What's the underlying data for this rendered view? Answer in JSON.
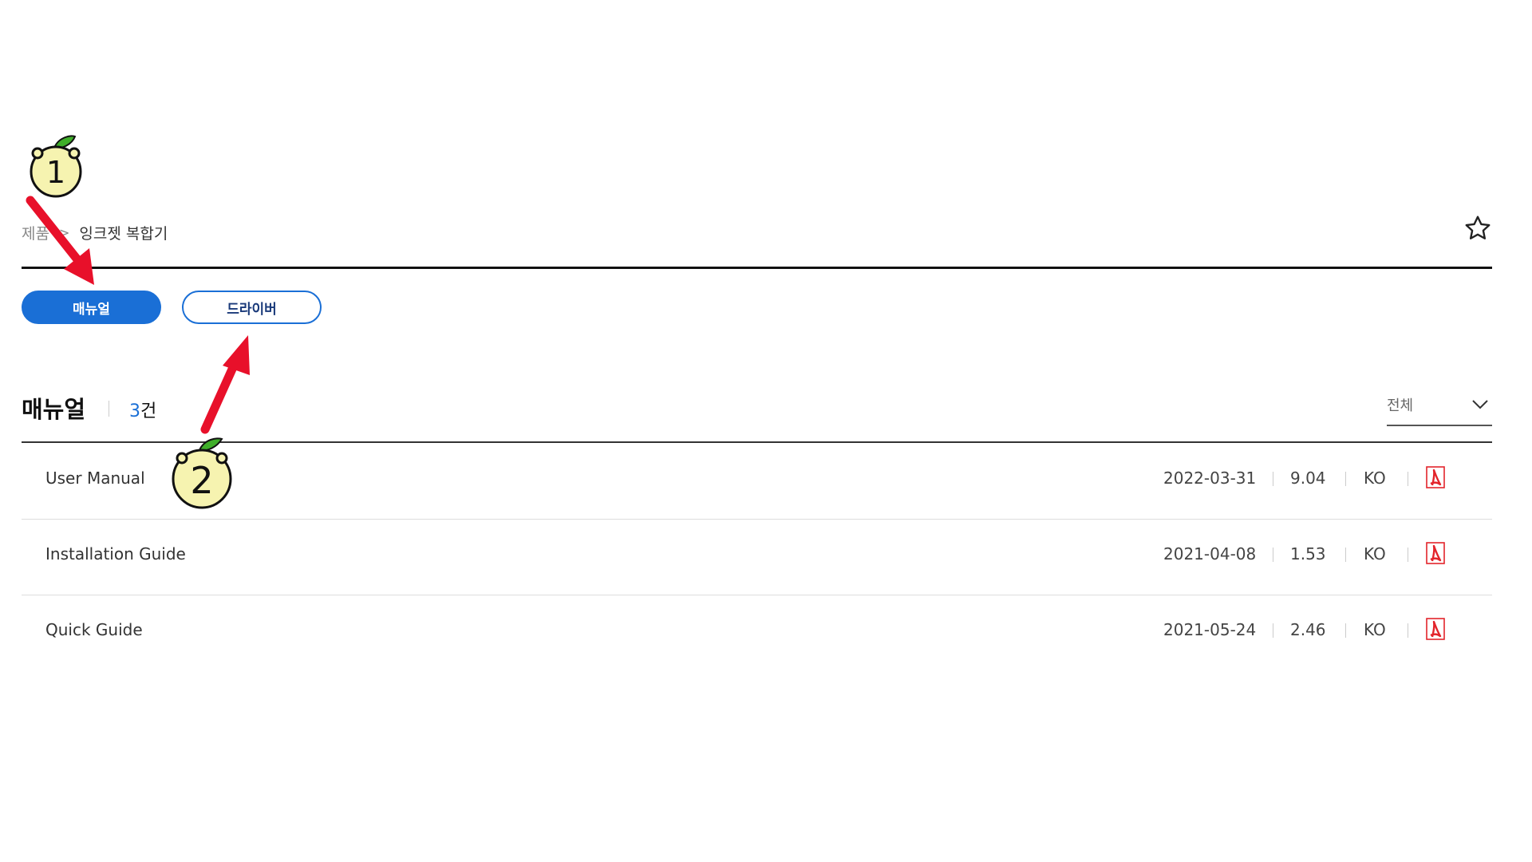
{
  "breadcrumb": {
    "root": "제품",
    "separator": ">",
    "current": "잉크젯 복합기"
  },
  "tabs": [
    {
      "label": "매뉴얼",
      "active": true
    },
    {
      "label": "드라이버",
      "active": false
    }
  ],
  "section": {
    "title": "매뉴얼",
    "count_number": "3",
    "count_unit": "건"
  },
  "filter": {
    "selected": "전체"
  },
  "documents": [
    {
      "title": "User Manual",
      "date": "2022-03-31",
      "size": "9.04",
      "lang": "KO"
    },
    {
      "title": "Installation Guide",
      "date": "2021-04-08",
      "size": "1.53",
      "lang": "KO"
    },
    {
      "title": "Quick Guide",
      "date": "2021-05-24",
      "size": "2.46",
      "lang": "KO"
    }
  ],
  "annotations": {
    "marker_1": "1",
    "marker_2": "2"
  },
  "colors": {
    "accent": "#1a6fd6",
    "arrow": "#e8102a",
    "pdf": "#e3242b",
    "marker_fill": "#f6f3b0",
    "leaf": "#3fae2a"
  },
  "icons": {
    "favorite": "star-icon",
    "filter": "chevron-down-icon",
    "file": "pdf-icon"
  }
}
